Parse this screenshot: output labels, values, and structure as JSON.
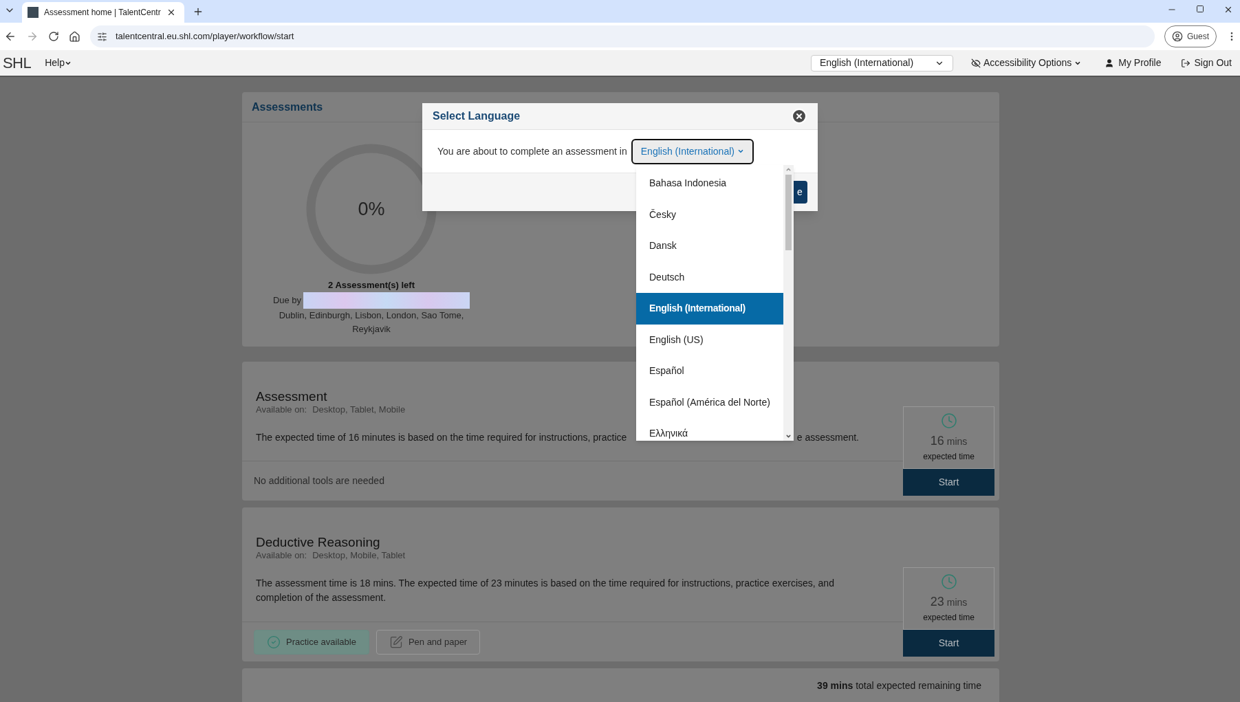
{
  "browser": {
    "tab_title": "Assessment home | TalentCentr",
    "url": "talentcentral.eu.shl.com/player/workflow/start",
    "profile": "Guest"
  },
  "header": {
    "logo": "SHL",
    "help": "Help",
    "language": "English (International)",
    "accessibility": "Accessibility Options",
    "profile": "My Profile",
    "sign_out": "Sign Out"
  },
  "summary": {
    "title": "Assessments",
    "progress": "0%",
    "left": "2 Assessment(s) left",
    "due_label": "Due by",
    "timezone": "Dublin, Edinburgh, Lisbon, London, Sao Tome, Reykjavik"
  },
  "assessments": [
    {
      "title": "Assessment",
      "available_label": "Available on:",
      "available": "Desktop, Tablet, Mobile",
      "description": [
        "The expected time of 16 minutes is based on the time required for instructions, practice",
        "e assessment."
      ],
      "minutes": "16",
      "unit": "mins",
      "expected": "expected time",
      "start": "Start",
      "tools_note": "No additional tools are needed"
    },
    {
      "title": "Deductive Reasoning",
      "available_label": "Available on:",
      "available": "Desktop, Mobile, Tablet",
      "description": [
        "The assessment time is 18 mins. The expected time of 23 minutes is based on the time required for instructions, practice exercises, and completion of the assessment."
      ],
      "minutes": "23",
      "unit": "mins",
      "expected": "expected time",
      "start": "Start",
      "tools": [
        {
          "kind": "practice",
          "label": "Practice available"
        },
        {
          "kind": "pen",
          "label": "Pen and paper"
        }
      ]
    }
  ],
  "total": {
    "value": "39 mins",
    "label": "total expected remaining time"
  },
  "modal": {
    "title": "Select Language",
    "prompt": "You are about to complete an assessment in",
    "language": "English (International)",
    "button_visible": "e"
  },
  "dropdown": {
    "items": [
      {
        "label": "Bahasa Indonesia",
        "selected": false
      },
      {
        "label": "Česky",
        "selected": false
      },
      {
        "label": "Dansk",
        "selected": false
      },
      {
        "label": "Deutsch",
        "selected": false
      },
      {
        "label": "English (International)",
        "selected": true
      },
      {
        "label": "English (US)",
        "selected": false
      },
      {
        "label": "Español",
        "selected": false
      },
      {
        "label": "Español (América del Norte)",
        "selected": false
      },
      {
        "label": "Ελληνικά",
        "selected": false
      }
    ]
  }
}
